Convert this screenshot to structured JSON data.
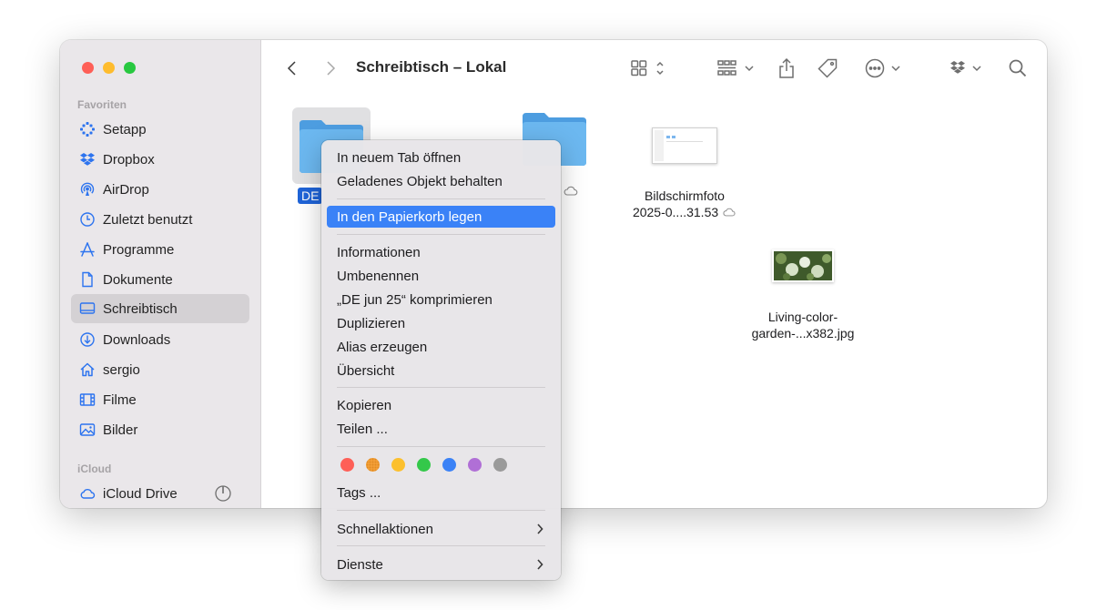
{
  "window": {
    "title": "Schreibtisch – Lokal"
  },
  "sidebar": {
    "favorites_title": "Favoriten",
    "items": [
      {
        "label": "Setapp",
        "icon": "setapp-icon"
      },
      {
        "label": "Dropbox",
        "icon": "dropbox-icon"
      },
      {
        "label": "AirDrop",
        "icon": "airdrop-icon"
      },
      {
        "label": "Zuletzt benutzt",
        "icon": "clock-icon"
      },
      {
        "label": "Programme",
        "icon": "apps-icon"
      },
      {
        "label": "Dokumente",
        "icon": "document-icon"
      },
      {
        "label": "Schreibtisch",
        "icon": "desktop-icon",
        "selected": true
      },
      {
        "label": "Downloads",
        "icon": "download-icon"
      },
      {
        "label": "sergio",
        "icon": "home-icon"
      },
      {
        "label": "Filme",
        "icon": "film-icon"
      },
      {
        "label": "Bilder",
        "icon": "photo-icon"
      }
    ],
    "icloud_title": "iCloud",
    "icloud_items": [
      {
        "label": "iCloud Drive",
        "icon": "cloud-icon"
      }
    ]
  },
  "toolbar": {
    "back": "back-icon",
    "forward": "forward-icon",
    "view": "grid-view-icon",
    "group": "group-icon",
    "share": "share-icon",
    "tag": "tag-icon",
    "more": "more-icon",
    "dropbox": "dropbox-icon",
    "search": "search-icon"
  },
  "files": [
    {
      "name": "DE",
      "selected": true
    },
    {
      "name": ""
    },
    {
      "name_line1": "Bildschirmfoto",
      "name_line2": "2025-0....31.53"
    },
    {
      "name_line1": "Living-color-",
      "name_line2": "garden-...x382.jpg"
    }
  ],
  "context_menu": {
    "items": [
      "In neuem Tab öffnen",
      "Geladenes Objekt behalten",
      "In den Papierkorb legen",
      "Informationen",
      "Umbenennen",
      "„DE jun 25“ komprimieren",
      "Duplizieren",
      "Alias erzeugen",
      "Übersicht",
      "Kopieren",
      "Teilen ...",
      "Tags ...",
      "Schnellaktionen",
      "Dienste"
    ],
    "highlighted_index": 2,
    "tag_colors": [
      "#fe5f57",
      "#f6a33a",
      "#fcc02e",
      "#34c84a",
      "#3b82f6",
      "#b06fd6",
      "#9a9a9a"
    ],
    "highlight_color": "#3a82f7"
  }
}
